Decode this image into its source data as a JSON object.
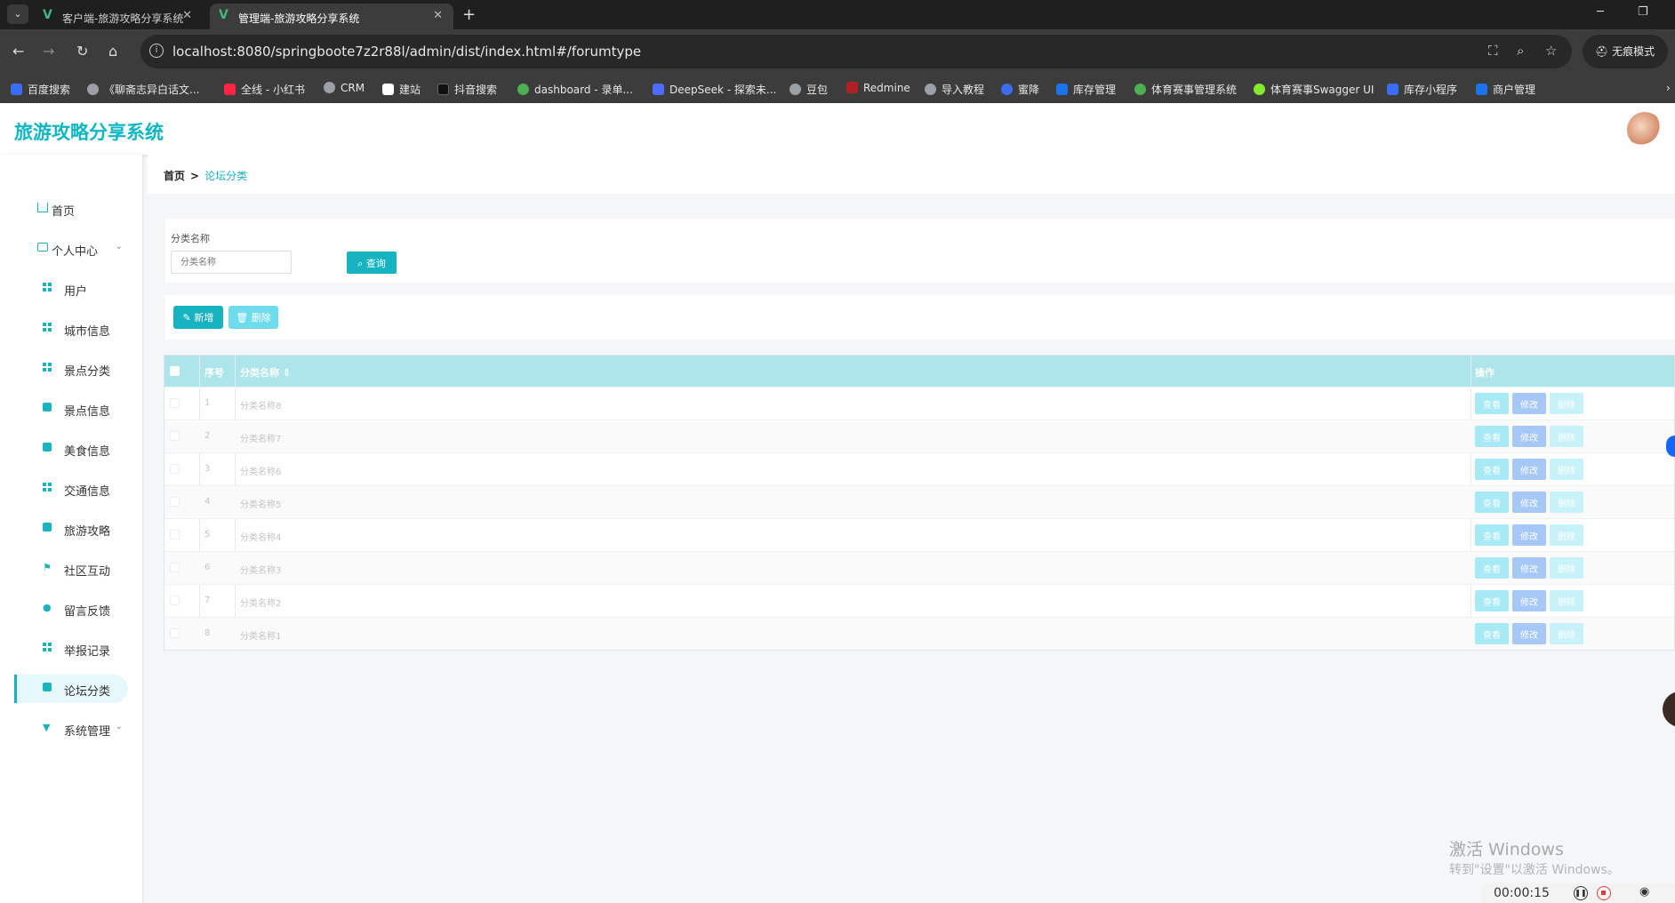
{
  "browser": {
    "tabs": [
      {
        "title": "客户端-旅游攻略分享系统",
        "active": false
      },
      {
        "title": "管理端-旅游攻略分享系统",
        "active": true
      }
    ],
    "url": "localhost:8080/springboote7z2r88l/admin/dist/index.html#/forumtype",
    "incognito_label": "无痕模式",
    "bookmarks": [
      {
        "label": "百度搜索",
        "color": "#3a6df0"
      },
      {
        "label": "《聊斋志异白话文...",
        "color": "#9aa0a6"
      },
      {
        "label": "全线 - 小红书",
        "color": "#ff2442"
      },
      {
        "label": "CRM",
        "color": "#9aa0a6"
      },
      {
        "label": "建站",
        "color": "#ffffff"
      },
      {
        "label": "抖音搜索",
        "color": "#111111"
      },
      {
        "label": "dashboard - 录单...",
        "color": "#4caf50"
      },
      {
        "label": "DeepSeek - 探索未...",
        "color": "#4d6bfe"
      },
      {
        "label": "豆包",
        "color": "#9aa0a6"
      },
      {
        "label": "Redmine",
        "color": "#b32024"
      },
      {
        "label": "导入教程",
        "color": "#9aa0a6"
      },
      {
        "label": "蜜降",
        "color": "#3a6df0"
      },
      {
        "label": "库存管理",
        "color": "#1a73e8"
      },
      {
        "label": "体育赛事管理系统",
        "color": "#4caf50"
      },
      {
        "label": "体育赛事Swagger UI",
        "color": "#85ea2d"
      },
      {
        "label": "库存小程序",
        "color": "#3a6df0"
      },
      {
        "label": "商户管理",
        "color": "#1a73e8"
      }
    ]
  },
  "app": {
    "title": "旅游攻略分享系统"
  },
  "sidebar": {
    "items": [
      {
        "label": "首页",
        "icon": "home-icon"
      },
      {
        "label": "个人中心",
        "icon": "id-card-icon"
      },
      {
        "label": "用户",
        "icon": "grid-icon"
      },
      {
        "label": "城市信息",
        "icon": "grid-icon"
      },
      {
        "label": "景点分类",
        "icon": "grid-icon"
      },
      {
        "label": "景点信息",
        "icon": "briefcase-icon"
      },
      {
        "label": "美食信息",
        "icon": "food-icon"
      },
      {
        "label": "交通信息",
        "icon": "grid-icon"
      },
      {
        "label": "旅游攻略",
        "icon": "document-icon"
      },
      {
        "label": "社区互动",
        "icon": "flag-icon"
      },
      {
        "label": "留言反馈",
        "icon": "location-icon"
      },
      {
        "label": "举报记录",
        "icon": "grid-icon"
      },
      {
        "label": "论坛分类",
        "icon": "clipboard-icon"
      },
      {
        "label": "系统管理",
        "icon": "trophy-icon"
      }
    ]
  },
  "breadcrumb": {
    "home": "首页",
    "separator": ">",
    "current": "论坛分类"
  },
  "search": {
    "label": "分类名称",
    "placeholder": "分类名称",
    "button": "查询"
  },
  "actions": {
    "add": "新增",
    "delete": "删除"
  },
  "table": {
    "columns": [
      "序号",
      "分类名称",
      "操作"
    ],
    "sort_indicator": "⇕",
    "rows": [
      {
        "index": "1",
        "name": "分类名称8"
      },
      {
        "index": "2",
        "name": "分类名称7"
      },
      {
        "index": "3",
        "name": "分类名称6"
      },
      {
        "index": "4",
        "name": "分类名称5"
      },
      {
        "index": "5",
        "name": "分类名称4"
      },
      {
        "index": "6",
        "name": "分类名称3"
      },
      {
        "index": "7",
        "name": "分类名称2"
      },
      {
        "index": "8",
        "name": "分类名称1"
      }
    ],
    "row_actions": {
      "view": "查看",
      "edit": "修改",
      "delete": "删除"
    }
  },
  "os": {
    "watermark_title": "激活 Windows",
    "watermark_sub": "转到\"设置\"以激活 Windows。",
    "recorder_time": "00:00:15"
  },
  "colors": {
    "accent": "#17b3c0",
    "table_header": "#ace6ea"
  }
}
